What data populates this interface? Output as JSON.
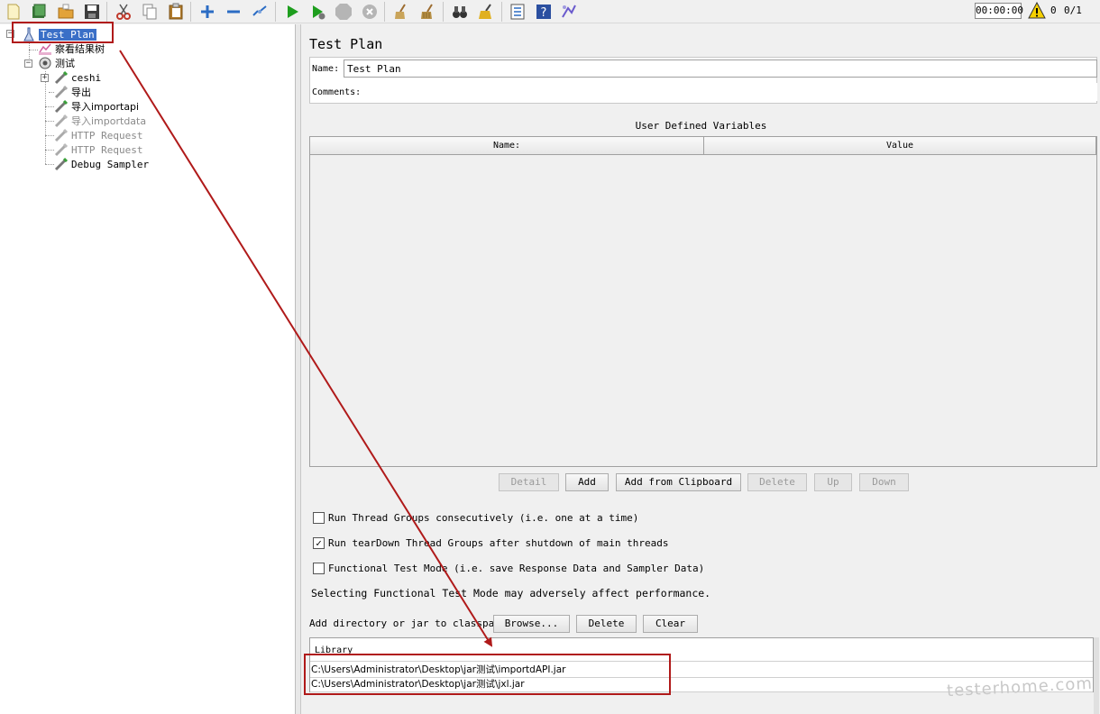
{
  "toolbar": {
    "buttons": [
      {
        "name": "new",
        "icon": "new-file-icon",
        "color": "#f7e9a0"
      },
      {
        "name": "templates",
        "icon": "templates-icon",
        "color": "#3a7d3a"
      },
      {
        "name": "open",
        "icon": "open-folder-icon",
        "color": "#e2a33a"
      },
      {
        "name": "save",
        "icon": "save-icon",
        "color": "#3d3d3d"
      },
      {
        "name": "cut",
        "icon": "cut-icon",
        "color": "#c0392b"
      },
      {
        "name": "copy",
        "icon": "copy-icon",
        "color": "#888888"
      },
      {
        "name": "paste",
        "icon": "paste-icon",
        "color": "#b07a2a"
      },
      {
        "name": "expand",
        "icon": "plus-icon",
        "color": "#2b6cc4"
      },
      {
        "name": "collapse",
        "icon": "minus-icon",
        "color": "#2b6cc4"
      },
      {
        "name": "toggle",
        "icon": "toggle-icon",
        "color": "#2b6cc4"
      },
      {
        "name": "start",
        "icon": "play-icon",
        "color": "#1e9e1e"
      },
      {
        "name": "start-no-pauses",
        "icon": "play-no-pause-icon",
        "color": "#1e9e1e"
      },
      {
        "name": "stop",
        "icon": "stop-icon",
        "color": "#a0a0a0"
      },
      {
        "name": "shutdown",
        "icon": "shutdown-icon",
        "color": "#a0a0a0"
      },
      {
        "name": "clear",
        "icon": "broom-icon",
        "color": "#9c6b2f"
      },
      {
        "name": "clear-all",
        "icon": "broom-all-icon",
        "color": "#9c6b2f"
      },
      {
        "name": "search",
        "icon": "binoculars-icon",
        "color": "#333333"
      },
      {
        "name": "reset-search",
        "icon": "reset-search-icon",
        "color": "#e0b020"
      },
      {
        "name": "function-helper",
        "icon": "list-icon",
        "color": "#2b6cc4"
      },
      {
        "name": "help",
        "icon": "help-icon",
        "color": "#2b4fa0"
      },
      {
        "name": "remote",
        "icon": "remote-icon",
        "color": "#6a5acd"
      }
    ],
    "timer": "00:00:00",
    "error_count": "0",
    "threads": "0/1"
  },
  "tree": {
    "nodes": [
      {
        "label": "Test Plan",
        "icon": "test-plan-icon",
        "selected": true,
        "disabled": false
      },
      {
        "label": "察看结果树",
        "icon": "listener-icon",
        "selected": false,
        "disabled": false
      },
      {
        "label": "测试",
        "icon": "thread-group-icon",
        "selected": false,
        "disabled": false
      },
      {
        "label": "ceshi",
        "icon": "sampler-icon",
        "selected": false,
        "disabled": false
      },
      {
        "label": "导出",
        "icon": "sampler-icon",
        "selected": false,
        "disabled": false
      },
      {
        "label": "导入importapi",
        "icon": "sampler-icon",
        "selected": false,
        "disabled": false
      },
      {
        "label": "导入importdata",
        "icon": "sampler-icon",
        "selected": false,
        "disabled": true
      },
      {
        "label": "HTTP Request",
        "icon": "sampler-icon",
        "selected": false,
        "disabled": true
      },
      {
        "label": "HTTP Request",
        "icon": "sampler-icon",
        "selected": false,
        "disabled": true
      },
      {
        "label": "Debug Sampler",
        "icon": "sampler-icon",
        "selected": false,
        "disabled": false
      }
    ]
  },
  "panel": {
    "title": "Test Plan",
    "name_label": "Name:",
    "name_value": "Test Plan",
    "comments_label": "Comments:",
    "comments_value": "",
    "udv_title": "User Defined Variables",
    "udv_columns": [
      "Name:",
      "Value"
    ],
    "udv_buttons": [
      {
        "label": "Detail",
        "enabled": false
      },
      {
        "label": "Add",
        "enabled": true
      },
      {
        "label": "Add from Clipboard",
        "enabled": true
      },
      {
        "label": "Delete",
        "enabled": false
      },
      {
        "label": "Up",
        "enabled": false
      },
      {
        "label": "Down",
        "enabled": false
      }
    ],
    "checkboxes": [
      {
        "label": "Run Thread Groups consecutively (i.e. one at a time)",
        "checked": false
      },
      {
        "label": "Run tearDown Thread Groups after shutdown of main threads",
        "checked": true
      },
      {
        "label": "Functional Test Mode (i.e. save Response Data and Sampler Data)",
        "checked": false
      }
    ],
    "functional_warning": "Selecting Functional Test Mode may adversely affect performance.",
    "classpath_label": "Add directory or jar to classpath",
    "classpath_buttons": [
      "Browse...",
      "Delete",
      "Clear"
    ],
    "library_header": "Library",
    "library_rows": [
      "C:\\Users\\Administrator\\Desktop\\jar测试\\importdAPI.jar",
      "C:\\Users\\Administrator\\Desktop\\jar测试\\jxl.jar"
    ]
  },
  "annotation": {
    "color": "#b01a1a"
  },
  "watermark": "testerhome.com"
}
